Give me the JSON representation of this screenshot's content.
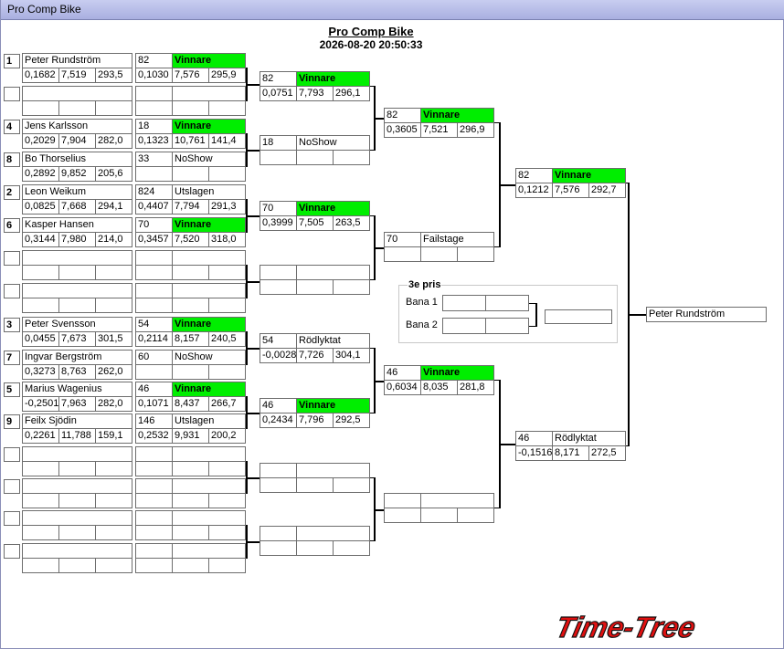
{
  "window": {
    "title": "Pro Comp Bike"
  },
  "header": {
    "title": "Pro Comp Bike",
    "datetime": "2026-08-20 20:50:33"
  },
  "seeds": [
    "1",
    "",
    "4",
    "8",
    "2",
    "6",
    "",
    "",
    "3",
    "7",
    "5",
    "9",
    "",
    "",
    "",
    ""
  ],
  "round1": [
    {
      "name": "Peter Rundström",
      "rt": "0,1682",
      "et": "7,519",
      "speed": "293,5",
      "no": "82",
      "status": "Vinnare",
      "rt2": "0,1030",
      "et2": "7,576",
      "speed2": "295,9",
      "win": true
    },
    {
      "name": "",
      "rt": "",
      "et": "",
      "speed": "",
      "no": "",
      "status": "",
      "rt2": "",
      "et2": "",
      "speed2": "",
      "win": false
    },
    {
      "name": "Jens Karlsson",
      "rt": "0,2029",
      "et": "7,904",
      "speed": "282,0",
      "no": "18",
      "status": "Vinnare",
      "rt2": "0,1323",
      "et2": "10,761",
      "speed2": "141,4",
      "win": true
    },
    {
      "name": "Bo Thorselius",
      "rt": "0,2892",
      "et": "9,852",
      "speed": "205,6",
      "no": "33",
      "status": "NoShow",
      "rt2": "",
      "et2": "",
      "speed2": "",
      "win": false
    },
    {
      "name": "Leon Weikum",
      "rt": "0,0825",
      "et": "7,668",
      "speed": "294,1",
      "no": "824",
      "status": "Utslagen",
      "rt2": "0,4407",
      "et2": "7,794",
      "speed2": "291,3",
      "win": false
    },
    {
      "name": "Kasper Hansen",
      "rt": "0,3144",
      "et": "7,980",
      "speed": "214,0",
      "no": "70",
      "status": "Vinnare",
      "rt2": "0,3457",
      "et2": "7,520",
      "speed2": "318,0",
      "win": true
    },
    {
      "name": "",
      "rt": "",
      "et": "",
      "speed": "",
      "no": "",
      "status": "",
      "rt2": "",
      "et2": "",
      "speed2": "",
      "win": false
    },
    {
      "name": "",
      "rt": "",
      "et": "",
      "speed": "",
      "no": "",
      "status": "",
      "rt2": "",
      "et2": "",
      "speed2": "",
      "win": false
    },
    {
      "name": "Peter Svensson",
      "rt": "0,0455",
      "et": "7,673",
      "speed": "301,5",
      "no": "54",
      "status": "Vinnare",
      "rt2": "0,2114",
      "et2": "8,157",
      "speed2": "240,5",
      "win": true
    },
    {
      "name": "Ingvar Bergström",
      "rt": "0,3273",
      "et": "8,763",
      "speed": "262,0",
      "no": "60",
      "status": "NoShow",
      "rt2": "",
      "et2": "",
      "speed2": "",
      "win": false
    },
    {
      "name": "Marius Wagenius",
      "rt": "-0,2501",
      "et": "7,963",
      "speed": "282,0",
      "no": "46",
      "status": "Vinnare",
      "rt2": "0,1071",
      "et2": "8,437",
      "speed2": "266,7",
      "win": true
    },
    {
      "name": "Feilx Sjödin",
      "rt": "0,2261",
      "et": "11,788",
      "speed": "159,1",
      "no": "146",
      "status": "Utslagen",
      "rt2": "0,2532",
      "et2": "9,931",
      "speed2": "200,2",
      "win": false
    },
    {
      "name": "",
      "rt": "",
      "et": "",
      "speed": "",
      "no": "",
      "status": "",
      "rt2": "",
      "et2": "",
      "speed2": "",
      "win": false
    },
    {
      "name": "",
      "rt": "",
      "et": "",
      "speed": "",
      "no": "",
      "status": "",
      "rt2": "",
      "et2": "",
      "speed2": "",
      "win": false
    },
    {
      "name": "",
      "rt": "",
      "et": "",
      "speed": "",
      "no": "",
      "status": "",
      "rt2": "",
      "et2": "",
      "speed2": "",
      "win": false
    },
    {
      "name": "",
      "rt": "",
      "et": "",
      "speed": "",
      "no": "",
      "status": "",
      "rt2": "",
      "et2": "",
      "speed2": "",
      "win": false
    }
  ],
  "round3": [
    {
      "no": "82",
      "status": "Vinnare",
      "rt": "0,0751",
      "et": "7,793",
      "speed": "296,1",
      "win": true
    },
    {
      "no": "18",
      "status": "NoShow",
      "rt": "",
      "et": "",
      "speed": "",
      "win": false
    },
    {
      "no": "70",
      "status": "Vinnare",
      "rt": "0,3999",
      "et": "7,505",
      "speed": "263,5",
      "win": true
    },
    {
      "no": "",
      "status": "",
      "rt": "",
      "et": "",
      "speed": "",
      "win": false
    },
    {
      "no": "54",
      "status": "Rödlyktat",
      "rt": "-0,0028",
      "et": "7,726",
      "speed": "304,1",
      "win": false
    },
    {
      "no": "46",
      "status": "Vinnare",
      "rt": "0,2434",
      "et": "7,796",
      "speed": "292,5",
      "win": true
    },
    {
      "no": "",
      "status": "",
      "rt": "",
      "et": "",
      "speed": "",
      "win": false
    },
    {
      "no": "",
      "status": "",
      "rt": "",
      "et": "",
      "speed": "",
      "win": false
    }
  ],
  "round4": [
    {
      "no": "82",
      "status": "Vinnare",
      "rt": "0,3605",
      "et": "7,521",
      "speed": "296,9",
      "win": true
    },
    {
      "no": "70",
      "status": "Failstage",
      "rt": "",
      "et": "",
      "speed": "",
      "win": false
    },
    {
      "no": "46",
      "status": "Vinnare",
      "rt": "0,6034",
      "et": "8,035",
      "speed": "281,8",
      "win": true
    },
    {
      "no": "",
      "status": "",
      "rt": "",
      "et": "",
      "speed": "",
      "win": false
    }
  ],
  "round5": [
    {
      "no": "82",
      "status": "Vinnare",
      "rt": "0,1212",
      "et": "7,576",
      "speed": "292,7",
      "win": true
    },
    {
      "no": "46",
      "status": "Rödlyktat",
      "rt": "-0,1516",
      "et": "8,171",
      "speed": "272,5",
      "win": false
    }
  ],
  "winner": {
    "name": "Peter Rundström"
  },
  "third_prize": {
    "title": "3e pris",
    "lane1": "Bana 1",
    "lane2": "Bana 2",
    "lane1_value": "",
    "lane2_value": "",
    "result": ""
  },
  "logo": {
    "text": "Time-Tree"
  },
  "colors": {
    "winner_green": "#00ee00",
    "titlebar": "#b4b9e6",
    "logo_red": "#e01010"
  }
}
